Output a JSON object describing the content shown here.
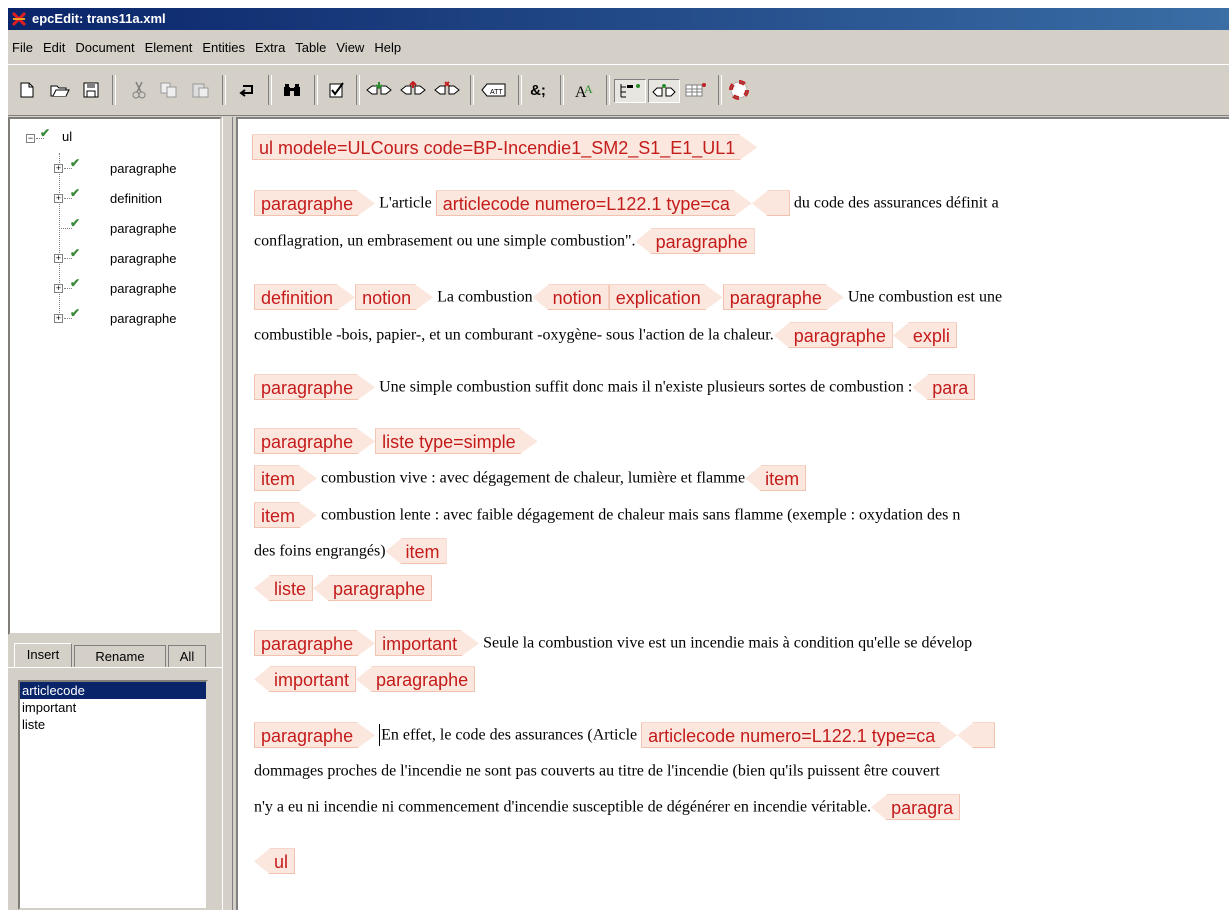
{
  "window": {
    "title": "epcEdit: trans11a.xml"
  },
  "menu": [
    "File",
    "Edit",
    "Document",
    "Element",
    "Entities",
    "Extra",
    "Table",
    "View",
    "Help"
  ],
  "toolbar": {
    "icons": [
      "new-document-icon",
      "open-folder-icon",
      "save-icon",
      "cut-icon",
      "copy-icon",
      "paste-icon",
      "undo-icon",
      "find-binoculars-icon",
      "validate-icon",
      "insert-element-icon",
      "insert-before-icon",
      "delete-element-icon",
      "attributes-icon",
      "entity-icon",
      "font-style-icon",
      "tree-view-icon",
      "tag-view-icon",
      "table-view-icon",
      "help-lifebuoy-icon"
    ],
    "att_label": "ATT",
    "entity_label": "&;"
  },
  "tree": {
    "root": "ul",
    "children": [
      "paragraphe",
      "definition",
      "paragraphe",
      "paragraphe",
      "paragraphe",
      "paragraphe"
    ]
  },
  "tabs": [
    "Insert",
    "Rename",
    "All"
  ],
  "insert_list": [
    "articlecode",
    "important",
    "liste"
  ],
  "insert_selected": "articlecode",
  "editor": {
    "l1_tag": "ul modele=ULCours code=BP-Incendie1_SM2_S1_E1_UL1",
    "p1_open": "paragraphe",
    "p1_text_a": "L'article",
    "p1_code": "articlecode numero=L122.1 type=ca",
    "p1_text_b": "du code des assurances définit a",
    "p1_text_c": "conflagration, un embrasement ou une simple combustion\".",
    "p1_close": "paragraphe",
    "d_open": "definition",
    "n_open": "notion",
    "n_text": "La combustion",
    "n_close": "notion",
    "e_open": "explication",
    "p2_open": "paragraphe",
    "p2_text_a": "Une combustion est une",
    "p2_text_b": "combustible -bois, papier-, et un comburant -oxygène- sous l'action de la chaleur.",
    "p2_close": "paragraphe",
    "e_close": "expli",
    "p3_open": "paragraphe",
    "p3_text": "Une simple combustion  suffit donc mais il n'existe plusieurs sortes de combustion :",
    "p3_close": "para",
    "p4_open": "paragraphe",
    "liste_open": "liste type=simple",
    "item1_open": "item",
    "item1_text": "combustion vive : avec dégagement de chaleur, lumière et flamme",
    "item1_close": "item",
    "item2_open": "item",
    "item2_text": "combustion lente : avec faible dégagement de chaleur mais sans flamme (exemple : oxydation des n",
    "item2_text_b": "des foins engrangés)",
    "item2_close": "item",
    "liste_close": "liste",
    "p4_close": "paragraphe",
    "p5_open": "paragraphe",
    "imp_open": "important",
    "p5_text": "Seule la combustion vive est un incendie mais à condition qu'elle se dévelop",
    "imp_close": "important",
    "p5_close": "paragraphe",
    "p6_open": "paragraphe",
    "p6_text_a": "En effet, le code des assurances (Article",
    "p6_code": "articlecode numero=L122.1 type=ca",
    "p6_text_b": "dommages proches de l'incendie ne sont pas couverts au titre de l'incendie (bien qu'ils puissent être couvert",
    "p6_text_c": "n'y a eu ni incendie ni commencement d'incendie susceptible de dégénérer en incendie véritable.",
    "p6_close": "paragra",
    "ul_close": "ul"
  },
  "colors": {
    "tag_text": "#c41b1b",
    "tag_bg": "#fbe7de",
    "title_bar": "#0a246a",
    "check": "#3a8a3a"
  }
}
